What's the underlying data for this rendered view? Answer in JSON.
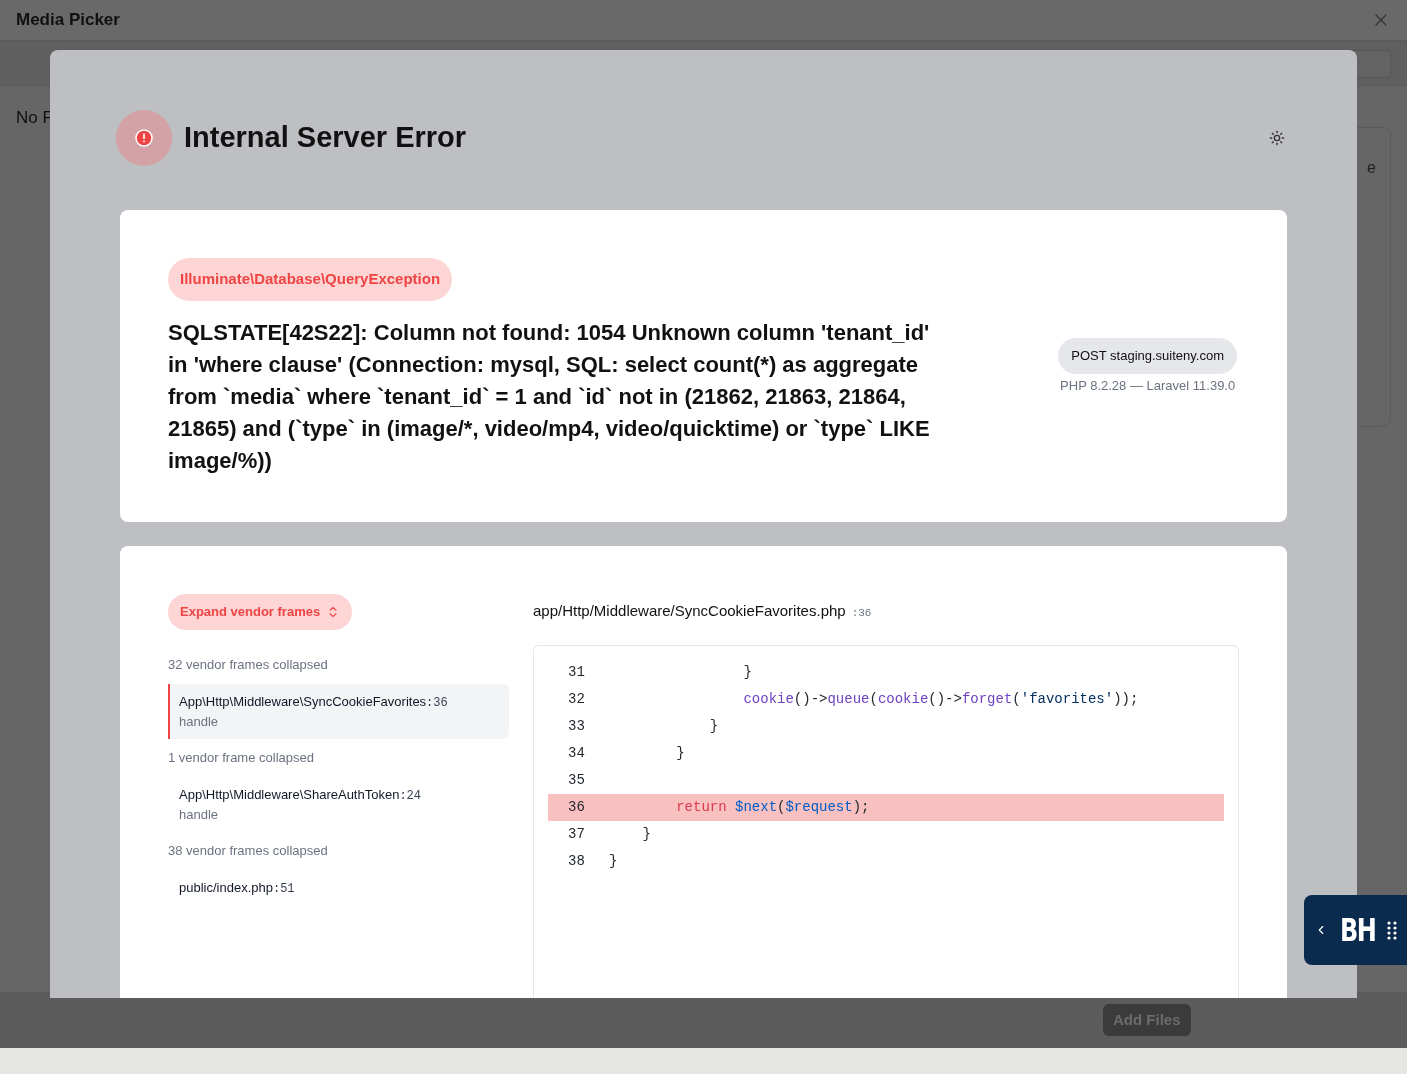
{
  "window": {
    "title": "Media Picker"
  },
  "background": {
    "empty_text": "No F",
    "side_text": "e",
    "add_button": "Add Files"
  },
  "error_page": {
    "title": "Internal Server Error",
    "exception": {
      "class": "Illuminate\\Database\\QueryException",
      "message": "SQLSTATE[42S22]: Column not found: 1054 Unknown column 'tenant_id' in 'where clause' (Connection: mysql, SQL: select count(*) as aggregate from `media` where `tenant_id` = 1 and `id` not in (21862, 21863, 21864, 21865) and (`type` in (image/*, video/mp4, video/quicktime) or `type` LIKE image/%))",
      "request": "POST staging.suiteny.com",
      "versions": "PHP 8.2.28 — Laravel 11.39.0"
    },
    "trace": {
      "expand_button": "Expand vendor frames",
      "frames": [
        {
          "kind": "collapsed",
          "text": "32 vendor frames collapsed"
        },
        {
          "kind": "frame",
          "class": "App\\Http\\Middleware\\SyncCookieFavorites",
          "line": ":36",
          "method": "handle",
          "selected": true
        },
        {
          "kind": "collapsed",
          "text": "1 vendor frame collapsed"
        },
        {
          "kind": "frame",
          "class": "App\\Http\\Middleware\\ShareAuthToken",
          "line": ":24",
          "method": "handle",
          "selected": false
        },
        {
          "kind": "collapsed",
          "text": "38 vendor frames collapsed"
        },
        {
          "kind": "frame",
          "class": "public/index.php",
          "line": ":51",
          "selected": false
        }
      ],
      "file": {
        "path": "app/Http/Middleware/SyncCookieFavorites.php",
        "line": ":36"
      },
      "code": [
        {
          "number": "31",
          "highlighted": false,
          "tokens": [
            {
              "kind": "plain",
              "text": "                }"
            }
          ]
        },
        {
          "number": "32",
          "highlighted": false,
          "tokens": [
            {
              "kind": "function",
              "text": "                cookie"
            },
            {
              "kind": "plain",
              "text": "()->"
            },
            {
              "kind": "function",
              "text": "queue"
            },
            {
              "kind": "plain",
              "text": "("
            },
            {
              "kind": "function",
              "text": "cookie"
            },
            {
              "kind": "plain",
              "text": "()->"
            },
            {
              "kind": "function",
              "text": "forget"
            },
            {
              "kind": "plain",
              "text": "("
            },
            {
              "kind": "string",
              "text": "'favorites'"
            },
            {
              "kind": "plain",
              "text": "));"
            }
          ]
        },
        {
          "number": "33",
          "highlighted": false,
          "tokens": [
            {
              "kind": "plain",
              "text": "            }"
            }
          ]
        },
        {
          "number": "34",
          "highlighted": false,
          "tokens": [
            {
              "kind": "plain",
              "text": "        }"
            }
          ]
        },
        {
          "number": "35",
          "highlighted": false
        },
        {
          "number": "36",
          "highlighted": true,
          "tokens": [
            {
              "kind": "keyword",
              "text": "        return "
            },
            {
              "kind": "variable",
              "text": "$next"
            },
            {
              "kind": "plain",
              "text": "("
            },
            {
              "kind": "variable",
              "text": "$request"
            },
            {
              "kind": "plain",
              "text": ");"
            }
          ]
        },
        {
          "number": "37",
          "highlighted": false,
          "tokens": [
            {
              "kind": "plain",
              "text": "    }"
            }
          ]
        },
        {
          "number": "38",
          "highlighted": false,
          "tokens": [
            {
              "kind": "plain",
              "text": "}"
            }
          ]
        }
      ]
    }
  },
  "widget": {
    "logo": "BH"
  }
}
